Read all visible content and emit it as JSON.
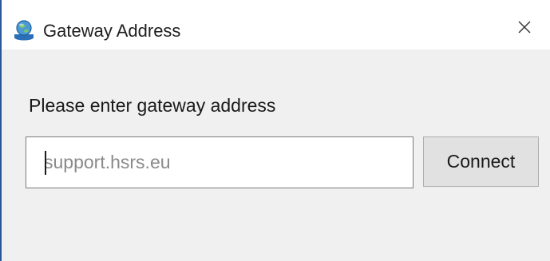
{
  "window": {
    "title": "Gateway Address",
    "icon": "gateway-app-icon",
    "close_icon": "close-icon"
  },
  "dialog": {
    "prompt": "Please enter gateway address",
    "address_input": {
      "value": "",
      "placeholder": "support.hsrs.eu"
    },
    "connect_label": "Connect"
  },
  "colors": {
    "accent_border": "#2b5797",
    "titlebar_bg": "#ffffff",
    "dialog_bg": "#f0f0f0",
    "button_bg": "#e1e1e1"
  }
}
